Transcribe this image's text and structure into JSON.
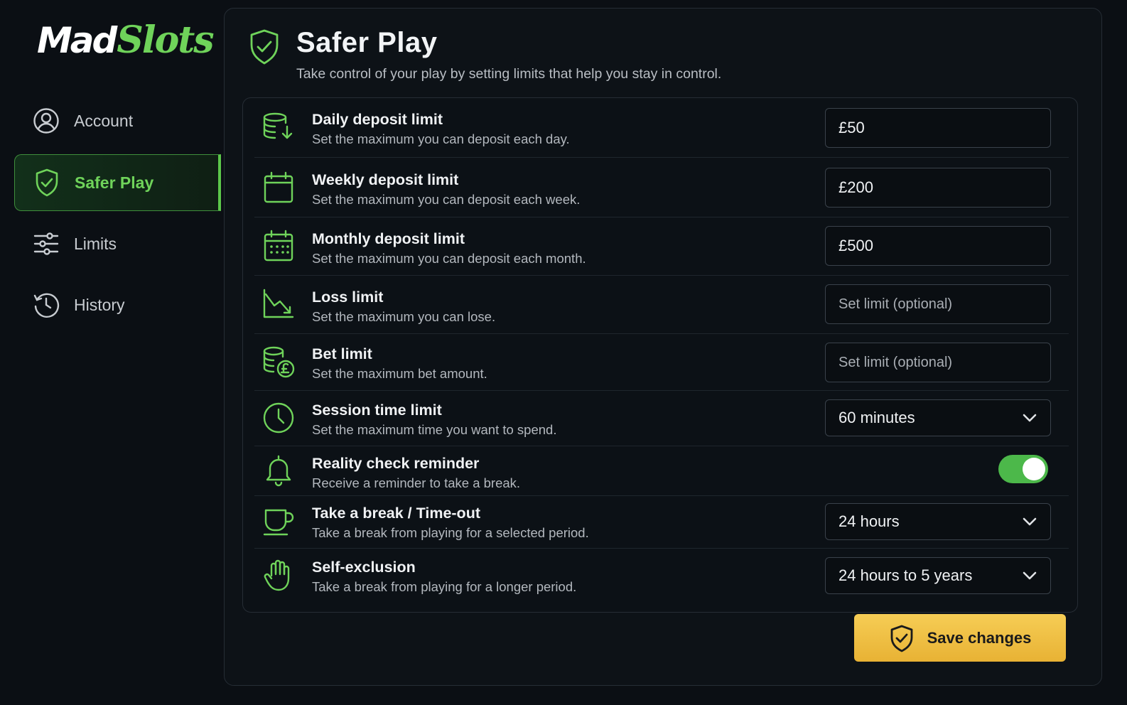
{
  "brand": {
    "name_part1": "Mad",
    "name_part2": "Slots",
    "accent_color": "#6fd35a"
  },
  "sidebar": {
    "items": [
      {
        "label": "Account",
        "icon": "user-circle-icon",
        "active": false
      },
      {
        "label": "Safer Play",
        "icon": "shield-check-icon",
        "active": true
      },
      {
        "label": "Limits",
        "icon": "sliders-icon",
        "active": false
      },
      {
        "label": "History",
        "icon": "clock-history-icon",
        "active": false
      }
    ]
  },
  "header": {
    "title": "Safer Play",
    "subtitle": "Take control of your play by setting limits that help you stay in control.",
    "icon": "shield-check-icon"
  },
  "settings": [
    {
      "title": "Daily deposit limit",
      "desc": "Set the maximum you can deposit each day.",
      "icon": "coins-down-icon",
      "control": "input",
      "value": "£50",
      "placeholder": ""
    },
    {
      "title": "Weekly deposit limit",
      "desc": "Set the maximum you can deposit each week.",
      "icon": "calendar-icon",
      "control": "input",
      "value": "£200",
      "placeholder": ""
    },
    {
      "title": "Monthly deposit limit",
      "desc": "Set the maximum you can deposit each month.",
      "icon": "calendar-grid-icon",
      "control": "input",
      "value": "£500",
      "placeholder": ""
    },
    {
      "title": "Loss limit",
      "desc": "Set the maximum you can lose.",
      "icon": "chart-down-icon",
      "control": "input",
      "value": "",
      "placeholder": "Set limit (optional)"
    },
    {
      "title": "Bet limit",
      "desc": "Set the maximum bet amount.",
      "icon": "coins-pound-icon",
      "control": "input",
      "value": "",
      "placeholder": "Set limit (optional)"
    },
    {
      "title": "Session time limit",
      "desc": "Set the maximum time you want to spend.",
      "icon": "clock-icon",
      "control": "select",
      "value": "60 minutes"
    },
    {
      "title": "Reality check reminder",
      "desc": "Receive a reminder to take a break.",
      "icon": "bell-icon",
      "control": "toggle",
      "on": true
    },
    {
      "title": "Take a break / Time-out",
      "desc": "Take a break from playing for a selected period.",
      "icon": "cup-icon",
      "control": "select",
      "value": "24 hours"
    },
    {
      "title": "Self-exclusion",
      "desc": "Take a break from playing for a longer period.",
      "icon": "hand-icon",
      "control": "select",
      "value": "24 hours to 5 years"
    }
  ],
  "save_button": {
    "label": "Save changes",
    "icon": "shield-check-icon"
  },
  "colors": {
    "background": "#0b0f14",
    "panel": "#0d1217",
    "green": "#4cb84a",
    "gold": "#f2c44a"
  }
}
